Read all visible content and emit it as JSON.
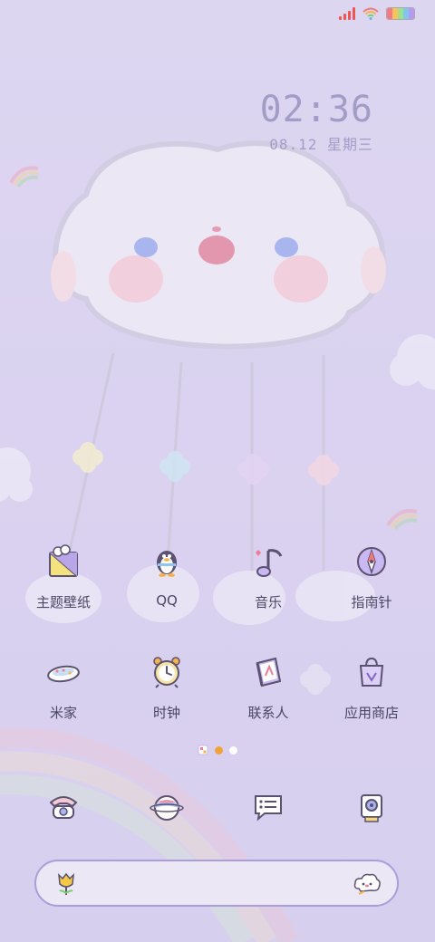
{
  "status_bar": {
    "signal_icon": "signal-bars-icon",
    "wifi_icon": "wifi-icon",
    "battery_icon": "rainbow-battery-icon",
    "signal_color": "#e55b4f",
    "battery_colors": [
      "#f47b85",
      "#f8c35c",
      "#9fe08a",
      "#7fc7f2",
      "#b59af0"
    ]
  },
  "clock": {
    "time": "02:36",
    "date": "08.12 星期三",
    "color": "#a29dc6"
  },
  "apps_row1": [
    {
      "label": "主题壁纸",
      "icon": "theme-wallpaper-icon"
    },
    {
      "label": "QQ",
      "icon": "qq-penguin-icon"
    },
    {
      "label": "音乐",
      "icon": "music-note-icon"
    },
    {
      "label": "指南针",
      "icon": "compass-icon"
    }
  ],
  "apps_row2": [
    {
      "label": "米家",
      "icon": "mijia-icon"
    },
    {
      "label": "时钟",
      "icon": "alarm-clock-icon"
    },
    {
      "label": "联系人",
      "icon": "contacts-book-icon"
    },
    {
      "label": "应用商店",
      "icon": "shopping-bag-icon"
    }
  ],
  "page_indicator": {
    "pages": 3,
    "active_index": 1,
    "active_color": "#f0a33a",
    "inactive_color": "#ffffff"
  },
  "dock": [
    {
      "icon": "telephone-icon"
    },
    {
      "icon": "planet-browser-icon"
    },
    {
      "icon": "message-bubble-icon"
    },
    {
      "icon": "camera-icon"
    }
  ],
  "search_bar": {
    "left_icon": "tulip-icon",
    "right_icon": "cloud-mascot-icon",
    "border_color": "#a99ed9"
  },
  "wallpaper": {
    "background_color": "#dcd5f0",
    "cloud_color": "#ece8f6",
    "cheek_color": "#f4c9d6",
    "eye_color": "#a9b5ef",
    "nose_color": "#e07c96"
  }
}
